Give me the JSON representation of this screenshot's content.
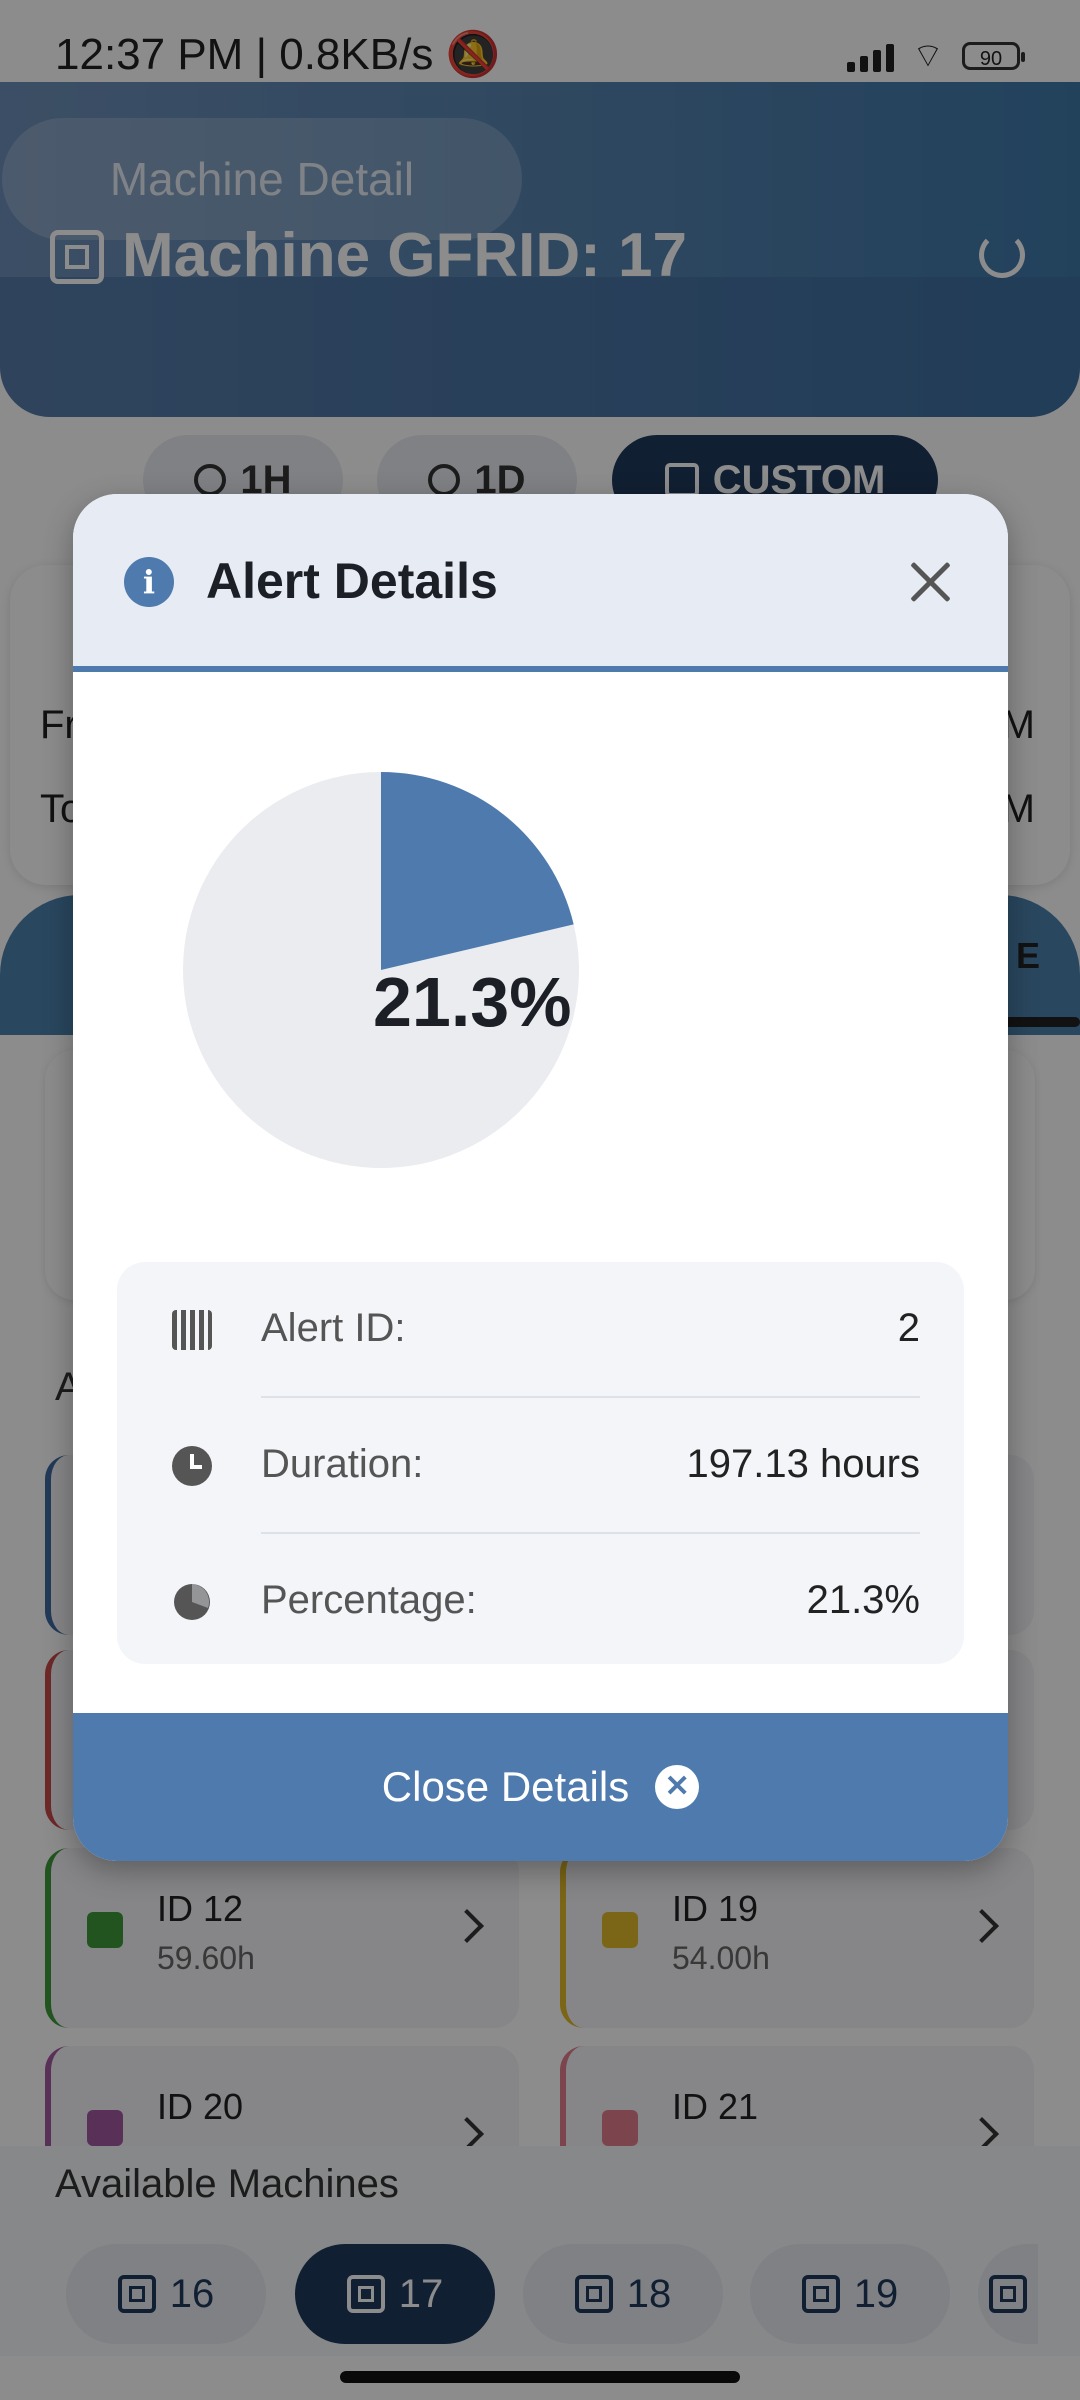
{
  "status_bar": {
    "time": "12:37 PM",
    "speed": "0.8KB/s",
    "battery": "90"
  },
  "header": {
    "nav_title": "Machine Detail",
    "title": "Machine GFRID: 17"
  },
  "ranges": [
    "1H",
    "1D",
    "CUSTOM"
  ],
  "date_card": {
    "from_prefix": "Fr",
    "to_prefix": "To",
    "from_suffix": "M",
    "to_suffix": "M"
  },
  "tabs": {
    "visible_tab_fragment": "E"
  },
  "section_fragment": "A",
  "alert_items": [
    {
      "id": "ID 12",
      "hours": "59.60h",
      "color": "#3f9a3a"
    },
    {
      "id": "ID 19",
      "hours": "54.00h",
      "color": "#e0b92a"
    },
    {
      "id": "ID 20",
      "hours": "",
      "color": "#a25aa0"
    },
    {
      "id": "ID 21",
      "hours": "",
      "color": "#e27d8a"
    }
  ],
  "machines": {
    "title": "Available Machines",
    "list": [
      "16",
      "17",
      "18",
      "19"
    ],
    "selected": "17"
  },
  "modal": {
    "title": "Alert Details",
    "pie_label": "21.3%",
    "rows": [
      {
        "icon": "barcode-icon",
        "label": "Alert ID:",
        "value": "2"
      },
      {
        "icon": "clock-icon",
        "label": "Duration:",
        "value": "197.13 hours"
      },
      {
        "icon": "pie-chart-icon",
        "label": "Percentage:",
        "value": "21.3%"
      }
    ],
    "close_label": "Close Details"
  },
  "chart_data": {
    "type": "pie",
    "slices": [
      {
        "label": "",
        "value": 21.3,
        "color": "#4f7aad"
      },
      {
        "label": "",
        "value": 78.7,
        "color": "#ebecf0"
      }
    ],
    "title": ""
  },
  "colors": {
    "accent": "#4f7aad",
    "dark_navy": "#1f3a5c"
  }
}
